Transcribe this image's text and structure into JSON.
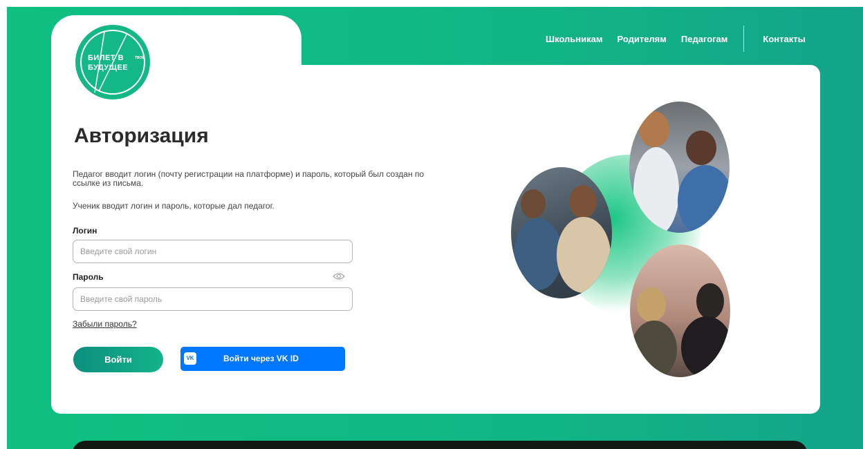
{
  "nav": {
    "items": [
      "Школьникам",
      "Родителям",
      "Педагогам"
    ],
    "contacts": "Контакты"
  },
  "logo": {
    "line1": "БИЛЕТ В",
    "line2": "БУДУЩЕЕ",
    "vertical": "ТВОЁ"
  },
  "form": {
    "title": "Авторизация",
    "description": "Педагог вводит логин (почту регистрации на платформе) и пароль, который был создан по ссылке из письма.",
    "student_note": "Ученик вводит логин и пароль, которые дал педагог.",
    "login_label": "Логин",
    "login_placeholder": "Введите свой логин",
    "password_label": "Пароль",
    "password_placeholder": "Введите свой пароль",
    "forgot_label": "Забыли пароль?",
    "login_button": "Войти",
    "vk_button": "Войти через VK ID",
    "vk_icon": "VK"
  },
  "colors": {
    "brand_green": "#11b684",
    "vk_blue": "#0077ff"
  },
  "icons": {
    "password_toggle": "eye-icon",
    "vk": "vk-icon"
  }
}
